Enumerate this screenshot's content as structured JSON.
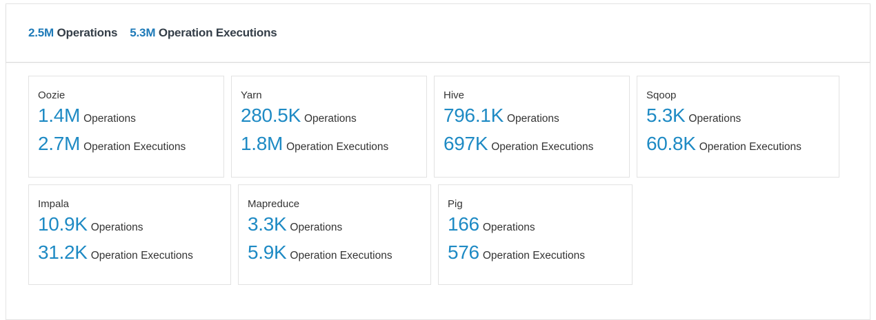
{
  "summary": {
    "operations_value": "2.5M",
    "operations_label": "Operations",
    "executions_value": "5.3M",
    "executions_label": "Operation Executions"
  },
  "cards": [
    {
      "name": "Oozie",
      "operations": "1.4M",
      "operations_label": "Operations",
      "executions": "2.7M",
      "executions_label": "Operation Executions"
    },
    {
      "name": "Yarn",
      "operations": "280.5K",
      "operations_label": "Operations",
      "executions": "1.8M",
      "executions_label": "Operation Executions"
    },
    {
      "name": "Hive",
      "operations": "796.1K",
      "operations_label": "Operations",
      "executions": "697K",
      "executions_label": "Operation Executions"
    },
    {
      "name": "Sqoop",
      "operations": "5.3K",
      "operations_label": "Operations",
      "executions": "60.8K",
      "executions_label": "Operation Executions"
    },
    {
      "name": "Impala",
      "operations": "10.9K",
      "operations_label": "Operations",
      "executions": "31.2K",
      "executions_label": "Operation Executions"
    },
    {
      "name": "Mapreduce",
      "operations": "3.3K",
      "operations_label": "Operations",
      "executions": "5.9K",
      "executions_label": "Operation Executions"
    },
    {
      "name": "Pig",
      "operations": "166",
      "operations_label": "Operations",
      "executions": "576",
      "executions_label": "Operation Executions"
    }
  ],
  "colors": {
    "accent": "#1e8ac4",
    "summary_number": "#1e7ab8",
    "text": "#333333",
    "border": "#e2e2e2"
  }
}
